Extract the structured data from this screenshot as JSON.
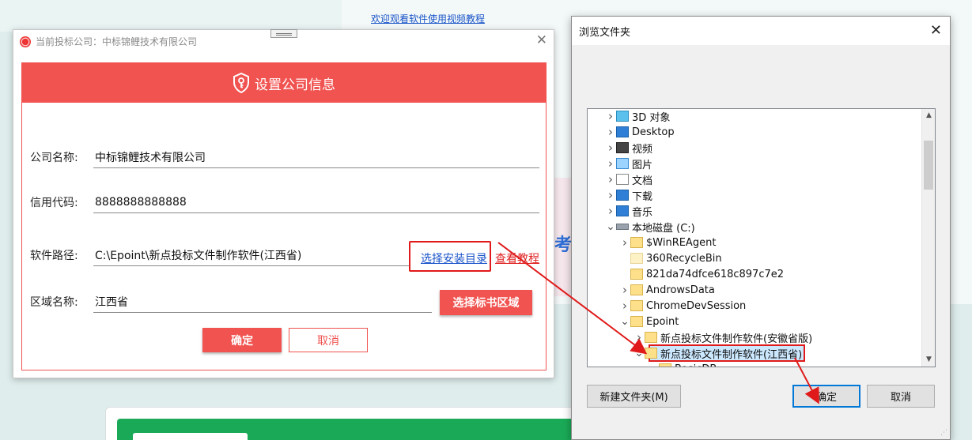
{
  "background": {
    "video_link": "欢迎观看软件使用视频教程",
    "partial_text": "考"
  },
  "company_dialog": {
    "title": "当前投标公司：中标锦鲤技术有限公司",
    "header": "设置公司信息",
    "fields": [
      {
        "label": "公司名称:",
        "value": "中标锦鲤技术有限公司"
      },
      {
        "label": "信用代码:",
        "value": "8888888888888"
      },
      {
        "label": "软件路径:",
        "value": "C:\\Epoint\\新点投标文件制作软件(江西省)"
      },
      {
        "label": "区域名称:",
        "value": "江西省"
      }
    ],
    "select_install_dir": "选择安装目录",
    "view_tutorial": "查看教程",
    "select_region": "选择标书区域",
    "ok": "确定",
    "cancel": "取消"
  },
  "browse_dialog": {
    "title": "浏览文件夹",
    "tree": [
      {
        "label": "3D 对象",
        "icon": "3d-objects-icon",
        "level": 1,
        "expander": "collapsed"
      },
      {
        "label": "Desktop",
        "icon": "desktop-icon",
        "level": 1,
        "expander": "collapsed"
      },
      {
        "label": "视频",
        "icon": "video-icon",
        "level": 1,
        "expander": "collapsed"
      },
      {
        "label": "图片",
        "icon": "picture-icon",
        "level": 1,
        "expander": "collapsed"
      },
      {
        "label": "文档",
        "icon": "document-icon",
        "level": 1,
        "expander": "collapsed"
      },
      {
        "label": "下载",
        "icon": "download-icon",
        "level": 1,
        "expander": "collapsed"
      },
      {
        "label": "音乐",
        "icon": "music-icon",
        "level": 1,
        "expander": "collapsed"
      },
      {
        "label": "本地磁盘 (C:)",
        "icon": "drive-icon",
        "level": 1,
        "expander": "expanded"
      },
      {
        "label": "$WinREAgent",
        "icon": "folder-icon",
        "level": 2,
        "expander": "collapsed"
      },
      {
        "label": "360RecycleBin",
        "icon": "folder-icon",
        "level": 2,
        "expander": "none"
      },
      {
        "label": "821da74dfce618c897c7e2",
        "icon": "folder-icon",
        "level": 2,
        "expander": "none"
      },
      {
        "label": "AndrowsData",
        "icon": "folder-icon",
        "level": 2,
        "expander": "collapsed"
      },
      {
        "label": "ChromeDevSession",
        "icon": "folder-icon",
        "level": 2,
        "expander": "collapsed"
      },
      {
        "label": "Epoint",
        "icon": "folder-icon",
        "level": 2,
        "expander": "expanded"
      },
      {
        "label": "新点投标文件制作软件(安徽省版)",
        "icon": "folder-icon",
        "level": 3,
        "expander": "collapsed"
      },
      {
        "label": "新点投标文件制作软件(江西省)",
        "icon": "folder-icon",
        "level": 3,
        "expander": "expanded",
        "selected": true
      },
      {
        "label": "BasicDB",
        "icon": "folder-icon",
        "level": 4,
        "expander": "none"
      }
    ],
    "new_folder": "新建文件夹(M)",
    "ok": "确定",
    "cancel": "取消"
  },
  "colors": {
    "accent_red": "#f05350",
    "highlight_red": "#e01a1a",
    "link_blue": "#1a55c9",
    "selection_blue": "#cce8ff",
    "focus_blue": "#0078d7"
  }
}
